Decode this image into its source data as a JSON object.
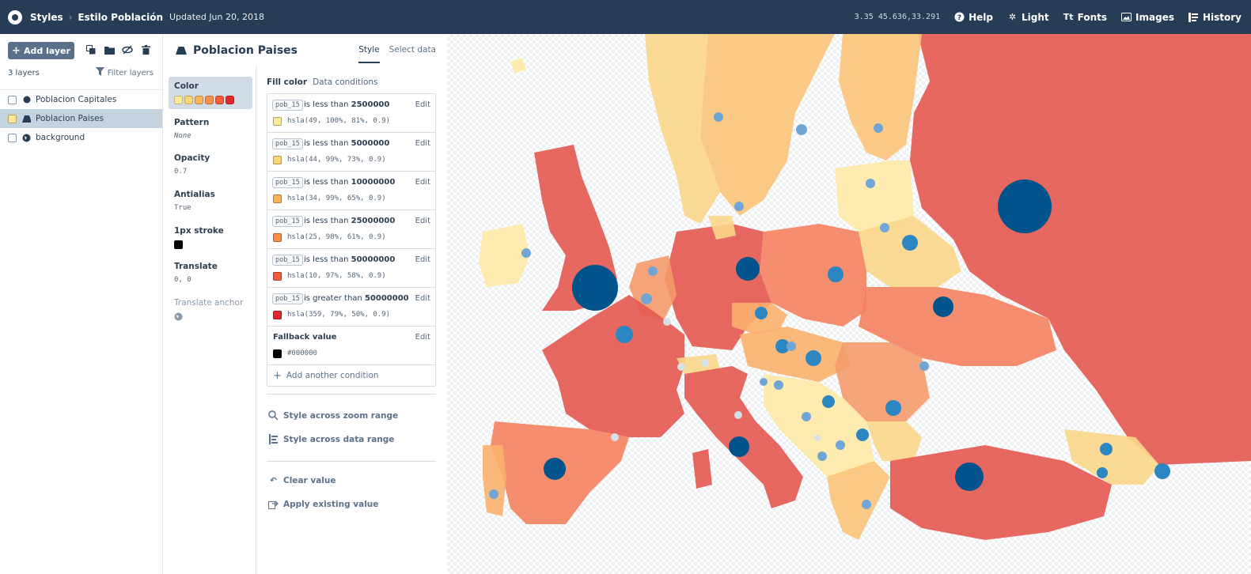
{
  "topbar": {
    "crumb_styles": "Styles",
    "style_name": "Estilo Población",
    "updated": "Updated Jun 20, 2018",
    "coords": "3.35 45.636,33.291",
    "help": "Help",
    "light": "Light",
    "fonts": "Fonts",
    "images": "Images",
    "history": "History"
  },
  "layers_panel": {
    "add_layer": "Add layer",
    "count": "3 layers",
    "filter": "Filter layers",
    "items": [
      {
        "label": "Poblacion Capitales",
        "icon": "circle-icon"
      },
      {
        "label": "Poblacion Paises",
        "icon": "fill-icon",
        "selected": true
      },
      {
        "label": "background",
        "icon": "background-icon"
      }
    ]
  },
  "editor": {
    "layer_name": "Poblacion Paises",
    "tab_style": "Style",
    "tab_select_data": "Select data",
    "properties": {
      "color": "Color",
      "pattern": "Pattern",
      "pattern_value": "None",
      "opacity": "Opacity",
      "opacity_value": "0.7",
      "antialias": "Antialias",
      "antialias_value": "True",
      "stroke": "1px stroke",
      "translate": "Translate",
      "translate_value": "0, 0",
      "translate_anchor": "Translate anchor"
    },
    "fill_color_tab": "Fill color",
    "data_conditions_tab": "Data conditions",
    "conditions": [
      {
        "field": "pob_15",
        "op": "is less than",
        "value": "2500000",
        "color": "hsla(49, 100%, 81%, 0.9)",
        "swatch": "#fde99a"
      },
      {
        "field": "pob_15",
        "op": "is less than",
        "value": "5000000",
        "color": "hsla(44, 99%, 73%, 0.9)",
        "swatch": "#fbd577"
      },
      {
        "field": "pob_15",
        "op": "is less than",
        "value": "10000000",
        "color": "hsla(34, 99%, 65%, 0.9)",
        "swatch": "#f9b35a"
      },
      {
        "field": "pob_15",
        "op": "is less than",
        "value": "25000000",
        "color": "hsla(25, 98%, 61%, 0.9)",
        "swatch": "#f8904a"
      },
      {
        "field": "pob_15",
        "op": "is less than",
        "value": "50000000",
        "color": "hsla(10, 97%, 58%, 0.9)",
        "swatch": "#f55c3c"
      },
      {
        "field": "pob_15",
        "op": "is greater than",
        "value": "50000000",
        "color": "hsla(359, 79%, 50%, 0.9)",
        "swatch": "#e3282c"
      }
    ],
    "edit_label": "Edit",
    "fallback_label": "Fallback value",
    "fallback_value": "#000000",
    "add_condition": "Add another condition",
    "zoom_range": "Style across zoom range",
    "data_range": "Style across data range",
    "clear_value": "Clear value",
    "apply_existing": "Apply existing value"
  }
}
